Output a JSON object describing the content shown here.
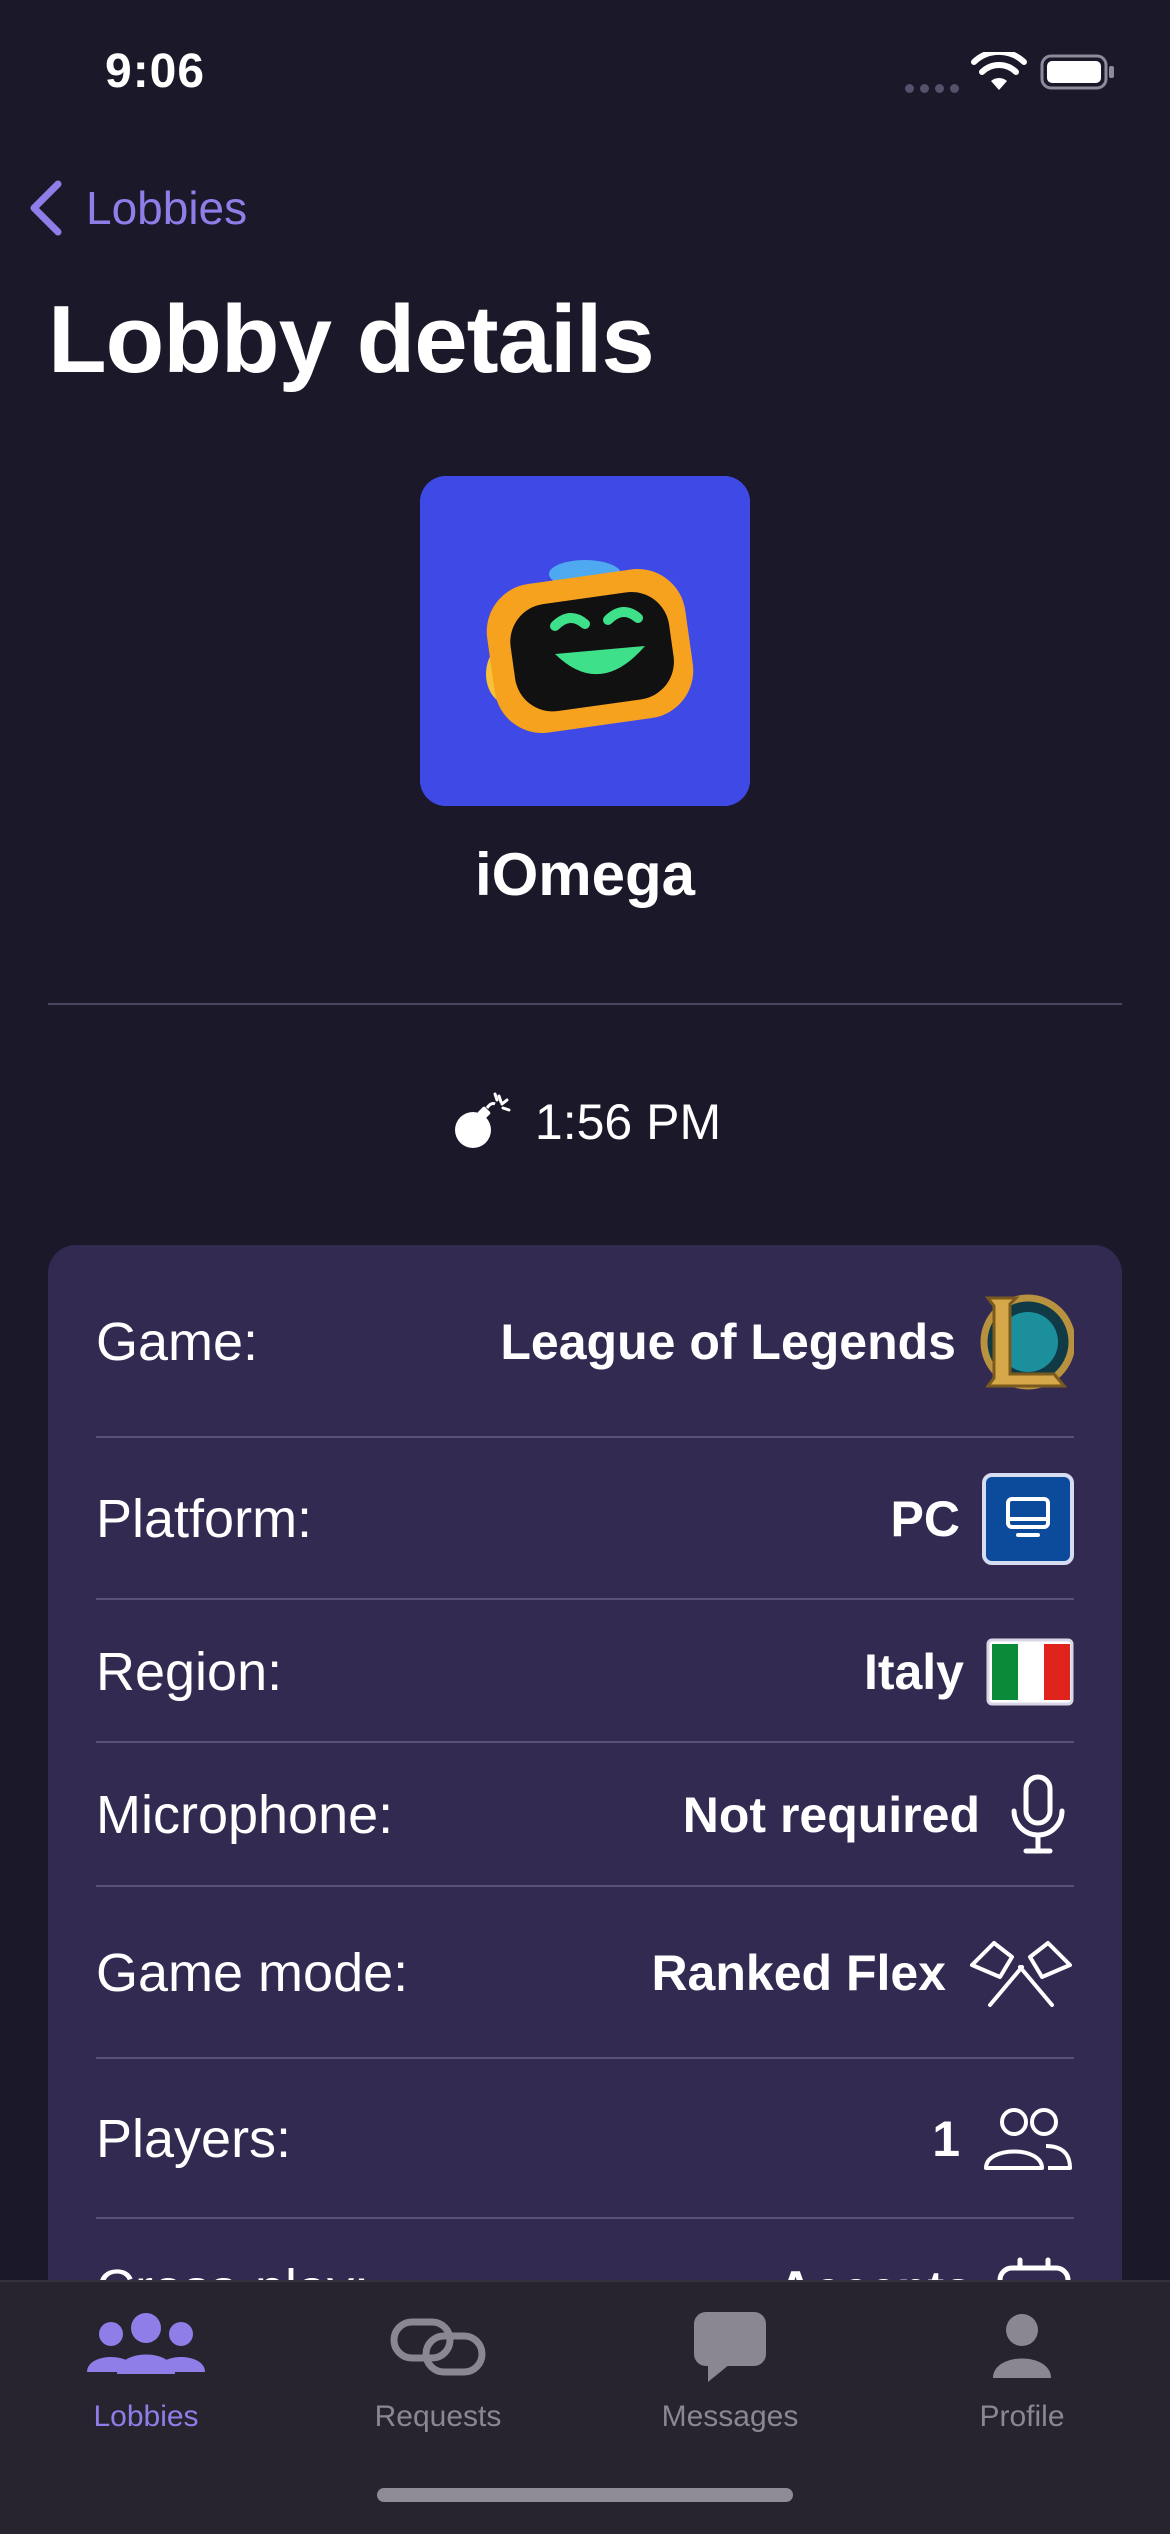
{
  "status_bar": {
    "time": "9:06"
  },
  "nav": {
    "back_label": "Lobbies"
  },
  "page": {
    "title": "Lobby details"
  },
  "lobby": {
    "owner": "iOmega",
    "expire_time": "1:56 PM",
    "details": [
      {
        "label": "Game:",
        "value": "League of Legends",
        "icon": "league-of-legends-logo-icon"
      },
      {
        "label": "Platform:",
        "value": "PC",
        "icon": "pc-icon"
      },
      {
        "label": "Region:",
        "value": "Italy",
        "icon": "italy-flag-icon"
      },
      {
        "label": "Microphone:",
        "value": "Not required",
        "icon": "microphone-icon"
      },
      {
        "label": "Game mode:",
        "value": "Ranked Flex",
        "icon": "crossed-flags-icon"
      },
      {
        "label": "Players:",
        "value": "1",
        "icon": "people-icon"
      },
      {
        "label": "Cross-play:",
        "value": "Accepts",
        "icon": "controller-icon"
      }
    ]
  },
  "tab_bar": {
    "tabs": [
      {
        "label": "Lobbies",
        "active": true
      },
      {
        "label": "Requests",
        "active": false
      },
      {
        "label": "Messages",
        "active": false
      },
      {
        "label": "Profile",
        "active": false
      }
    ]
  },
  "colors": {
    "background": "#1b1829",
    "card": "#332a52",
    "accent": "#8f7ee8",
    "avatar_bg": "#3f4ae6"
  }
}
